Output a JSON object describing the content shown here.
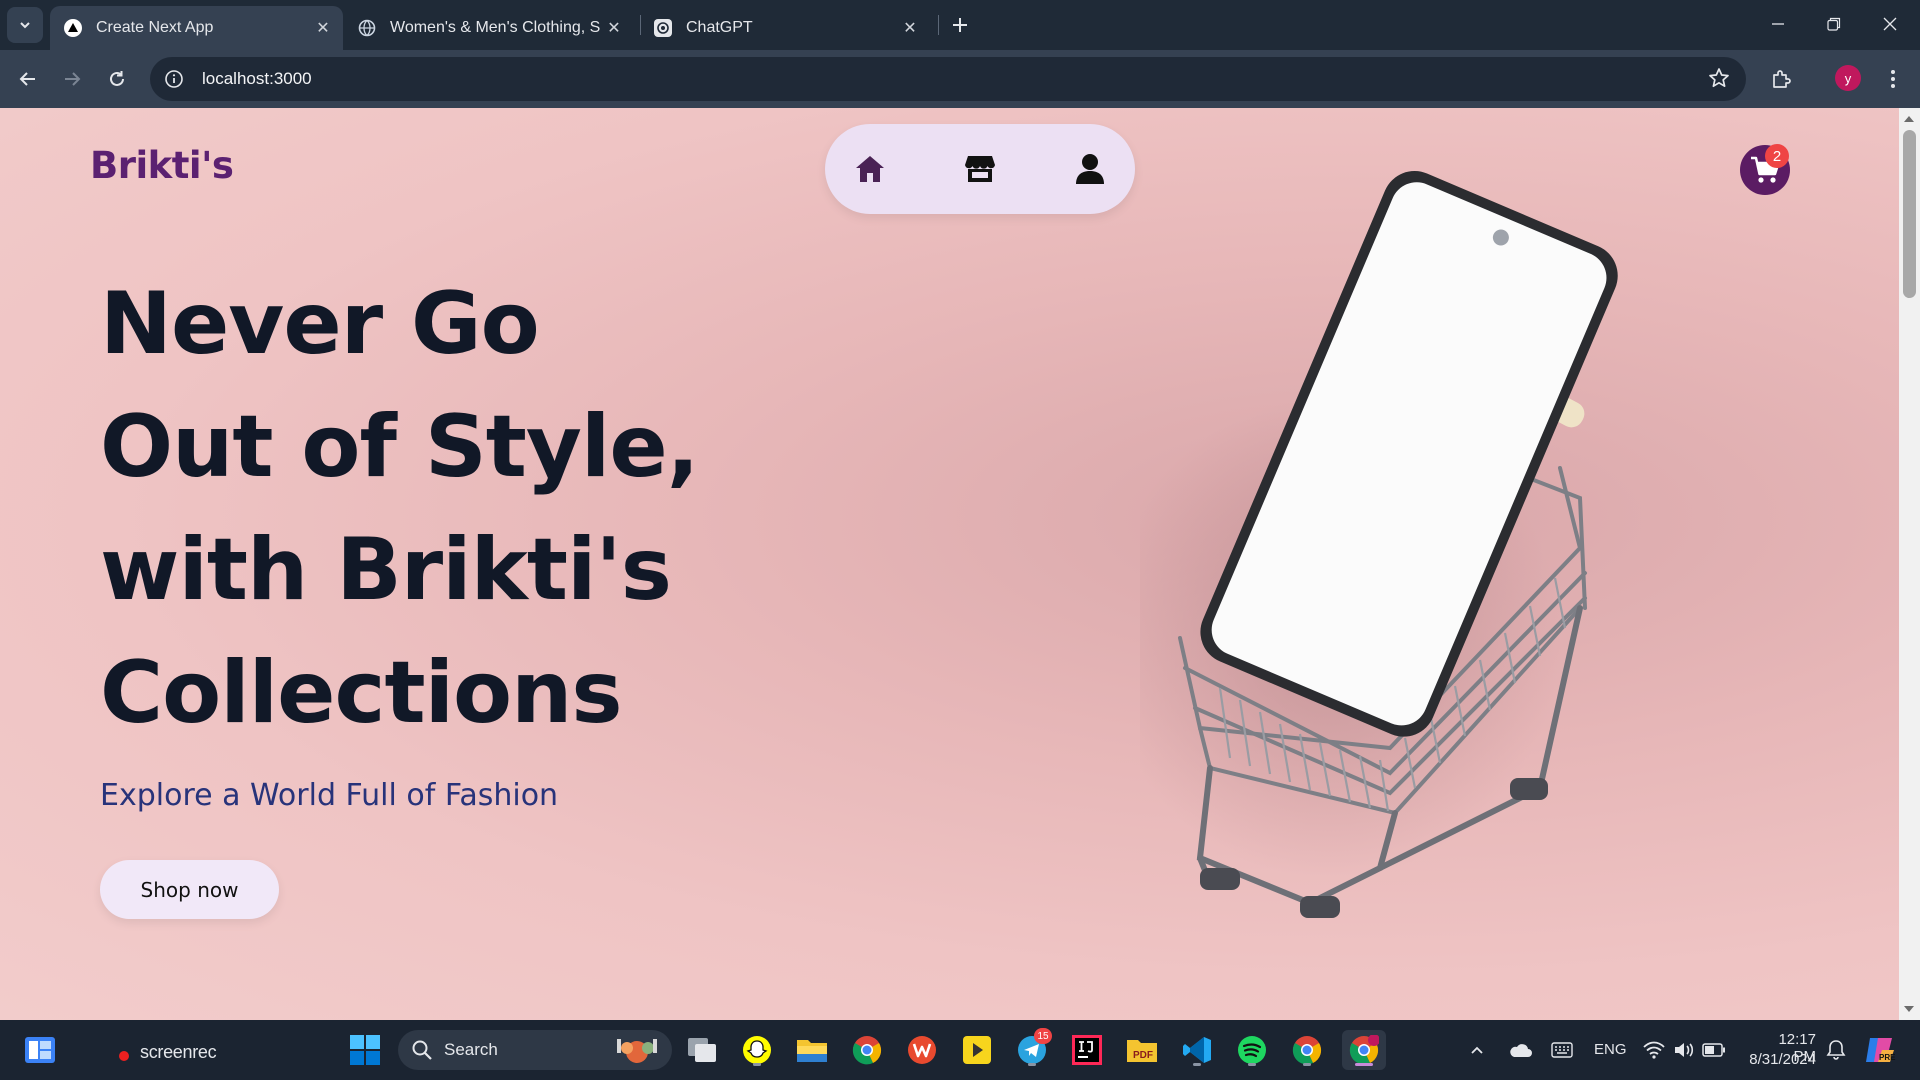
{
  "browser": {
    "tabs": [
      {
        "title": "Create Next App",
        "active": true
      },
      {
        "title": "Women's & Men's Clothing, Sh",
        "active": false
      },
      {
        "title": "ChatGPT",
        "active": false
      }
    ],
    "url": "localhost:3000",
    "profile_initial": "y"
  },
  "page": {
    "brand": "Brikti's",
    "nav_icons": [
      "home-icon",
      "store-icon",
      "user-icon"
    ],
    "cart_count": "2",
    "hero_title": "Never Go Out of Style, with Brikti's Collections",
    "hero_subtitle": "Explore a World Full of Fashion",
    "cta_label": "Shop now",
    "colors": {
      "brand": "#5b2171",
      "cart": "#5b1c63",
      "subtitle": "#28337a",
      "background": "#efc4c4"
    }
  },
  "taskbar": {
    "recorder_label": "screenrec",
    "search_label": "Search",
    "telegram_badge": "15",
    "language": "ENG",
    "time": "12:17 PM",
    "date": "8/31/2024",
    "apps": [
      "snapchat-icon",
      "file-explorer-icon",
      "chrome-icon",
      "wps-icon",
      "player-icon",
      "telegram-icon",
      "intellij-icon",
      "pdf-icon",
      "vscode-icon",
      "spotify-icon",
      "chrome-icon",
      "chrome-profile-icon"
    ]
  }
}
